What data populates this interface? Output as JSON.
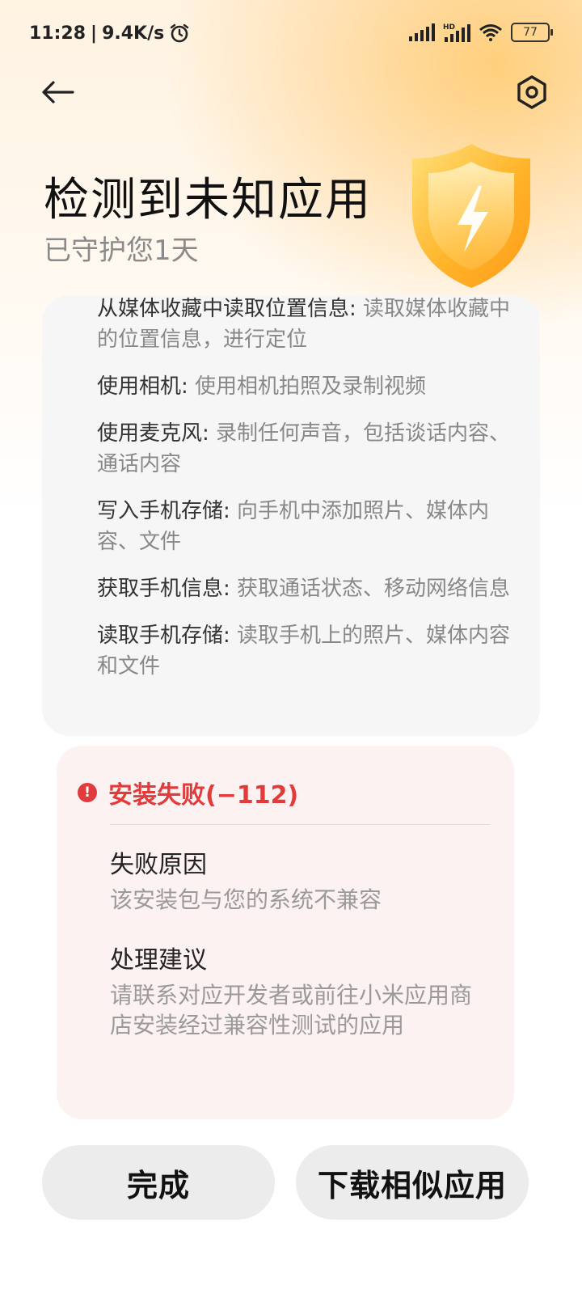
{
  "status_bar": {
    "time": "11:28",
    "separator": "|",
    "speed": "9.4K/s",
    "battery": "77",
    "icons": [
      "alarm-icon",
      "signal-icon",
      "hd-signal-icon",
      "wifi-icon",
      "battery-icon"
    ]
  },
  "header": {
    "back_icon": "back-arrow-icon",
    "settings_icon": "settings-icon",
    "title": "检测到未知应用",
    "subtitle": "已守护您1天",
    "illustration": "shield-lightning-icon"
  },
  "permissions": [
    {
      "name": "从媒体收藏中读取位置信息:",
      "desc": "读取媒体收藏中的位置信息，进行定位"
    },
    {
      "name": "使用相机:",
      "desc": "使用相机拍照及录制视频"
    },
    {
      "name": "使用麦克风:",
      "desc": "录制任何声音，包括谈话内容、通话内容"
    },
    {
      "name": "写入手机存储:",
      "desc": "向手机中添加照片、媒体内容、文件"
    },
    {
      "name": "获取手机信息:",
      "desc": "获取通话状态、移动网络信息"
    },
    {
      "name": "读取手机存储:",
      "desc": "读取手机上的照片、媒体内容和文件"
    }
  ],
  "error": {
    "icon": "!",
    "title": "安装失败(−112)",
    "reason_label": "失败原因",
    "reason_text": "该安装包与您的系统不兼容",
    "advice_label": "处理建议",
    "advice_text": "请联系对应开发者或前往小米应用商店安装经过兼容性测试的应用",
    "colors": {
      "accent": "#e23b3b",
      "background": "#fdf2f2"
    }
  },
  "buttons": {
    "done": "完成",
    "download_similar": "下载相似应用"
  }
}
